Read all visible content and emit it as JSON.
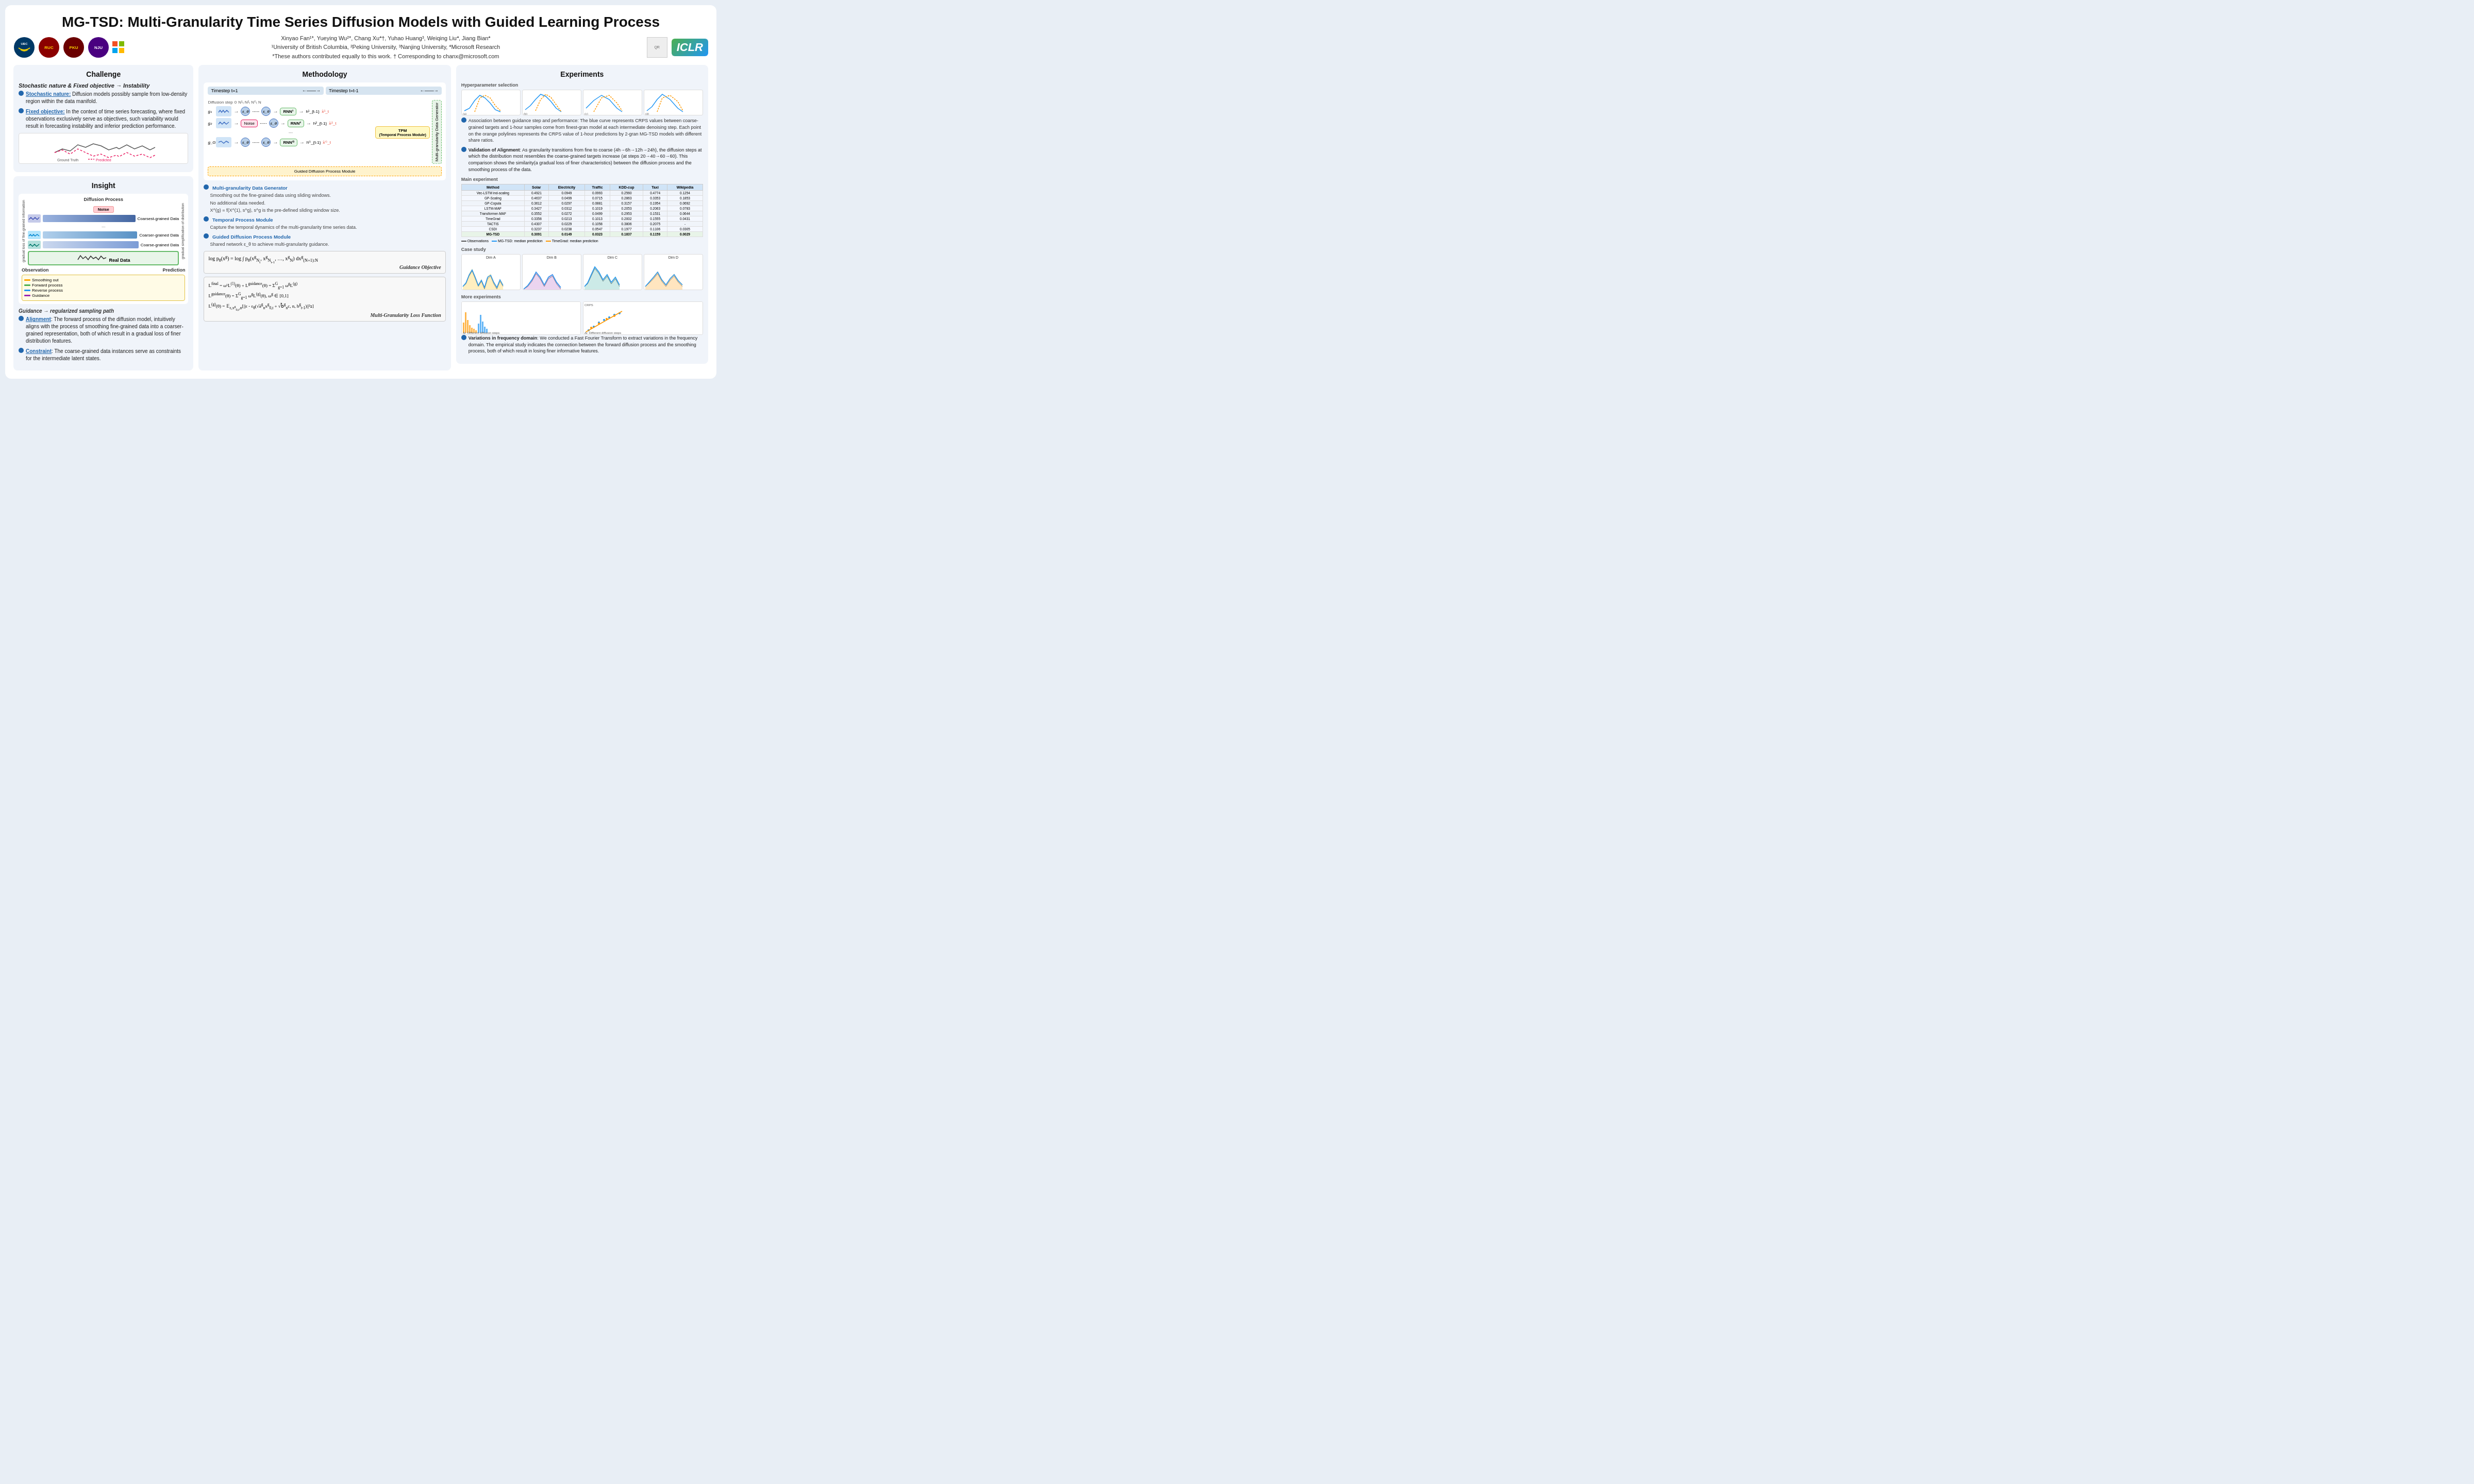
{
  "title": "MG-TSD: Multi-Granularity Time Series Diffusion Models with Guided Learning Process",
  "authors": "Xinyao Fan¹*, Yueying Wu²*, Chang Xu⁴†, Yuhao Huang³, Weiqing Liu⁴, Jiang Bian⁴",
  "affiliations": "¹University of British Columbia, ²Peking University, ³Nanjing University, ⁴Microsoft Research",
  "note": "*These authors contributed equally to this work.  † Corresponding to chanx@microsoft.com",
  "conference": "ICLR",
  "challenge": {
    "title": "Challenge",
    "subtitle": "Stochastic nature & Fixed objective → Instability",
    "bullet1_title": "Stochastic nature:",
    "bullet1_text": "Diffusion models possibly sample from low-density region within the data manifold.",
    "bullet2_title": "Fixed objective:",
    "bullet2_text": "In the context of time series forecasting, where fixed observations exclusively serve as objectives, such variability would result in forecasting instability and inferior prediction performance.",
    "chart_label1": "Ground Truth",
    "chart_label2": "Predicted"
  },
  "insight": {
    "title": "Insight",
    "diffusion_process": "Diffusion Process",
    "noise_label": "Noise",
    "coarsest_label": "Coarsest-grained Data",
    "coarser_label": "Coarser-grained Data",
    "coarse_label": "Coarse-grained Data",
    "real_data_label": "Real Data",
    "observation_label": "Observation",
    "prediction_label": "Prediction",
    "gradient_label": "gradual loss of fine-grained information",
    "gradient_label2": "gradual simplification of distribution",
    "legend_smooth": "Smoothing out",
    "legend_forward": "Forward process",
    "legend_reverse": "Reverse process",
    "legend_guidance": "Guidance",
    "guidance_text": "Guidance → regularized sampling path",
    "align_title": "Alignment",
    "align_text": "The forward process of the diffusion model, intuitively aligns with the process of smoothing fine-grained data into a coarser-grained representation, both of which result in a gradual loss of finer distribution features.",
    "constraint_title": "Constraint",
    "constraint_text": "The coarse-grained data instances serve as constraints for the intermediate latent states."
  },
  "methodology": {
    "title": "Methodology",
    "timestep_label": "Timestep t=1",
    "timestep_label2": "Timestep t=t-1",
    "tpm_label": "TPM\n(Temporal Process Module)",
    "gdp_label": "Guided Diffusion Process Module",
    "multi_gran_label": "Multi-granularity Data Generator",
    "bullet1_title": "Multi-granularity Data Generator",
    "bullet1_sub1": "Smoothing out the fine-grained data using sliding windows.",
    "bullet1_sub2": "No additional data needed.",
    "bullet1_sub3": "X^(g) = f(X^(1), s^g), s^g is the pre-defined sliding window size.",
    "bullet2_title": "Temporal Process Module",
    "bullet2_sub1": "Capture the temporal dynamics of the multi-granularity time series data.",
    "bullet3_title": "Guided Diffusion Process Module",
    "bullet3_sub1": "Shared network ε_θ to achieve multi-granularity guidance.",
    "guidance_formula": "log p_θ(x^g) = log ∫ p_θ(x^g_{N_t}, x^g_{N_{t-1}}, …, x^g_N) dx^g_{(N+1):N}",
    "guidance_title": "Guidance Objective",
    "loss_formula1": "L^final = ω¹L^(1)(θ) + L^guidance(θ) = Σ^G_{g=1} ω^g L^(g)",
    "loss_formula2": "L^guidance(θ) = Σ^G_{g=1} ω^g L^(g)(θ), ω^g ∈ [0,1]",
    "loss_formula3": "L^(g)(θ) = E_{ε,x^g_{0,t},n}[||ε - ε_θ(√ā^g_n x^g_{0,t} + √b^g_n c, n, h^g_{t-1})||²₂]",
    "loss_title": "Multi-Granularity Loss Function"
  },
  "experiments": {
    "title": "Experiments",
    "hyp_title": "Hyperparameter selection",
    "hyp_text": "Association between guidance step and performance: The blue curve represents CRPS values between coarse-grained targets and 1-hour samples come from finest-gran model at each intermediate denoising step. Each point on the orange polylines represents the CRPS value of 1-hour predictions by 2-gran MG-TSD models with different share ratios.",
    "align_title": "Validation of Alignment",
    "align_text": "As granularity transitions from fine to coarse (4h→6h→12h→24h), the diffusion steps at which the distribution most resembles the coarse-grained targets increase (at steps 20→40→60→60). This comparison shows the similarity(a gradual loss of finer characteristics) between the diffusion process and the smoothing process of the data.",
    "table_headers": [
      "Method",
      "Solar",
      "Electricity",
      "Traffic",
      "KDD-cup",
      "Taxi",
      "Wikipedia"
    ],
    "table_rows": [
      [
        "Vec-LSTM ind-scaling",
        "0.4921",
        "0.0949",
        "0.0993",
        "0.2560",
        "0.4774",
        "0.1254"
      ],
      [
        "GP-Scaling",
        "0.4637",
        "0.0499",
        "0.0715",
        "0.2863",
        "0.3353",
        "0.1853"
      ],
      [
        "GP-Copula",
        "0.3612",
        "0.0297",
        "0.0881",
        "0.3157",
        "0.1954",
        "0.0692"
      ],
      [
        "LSTM-MAF",
        "0.3427",
        "0.0312",
        "0.1019",
        "0.2053",
        "0.2063",
        "0.0783"
      ],
      [
        "Transformer-MAF",
        "0.3552",
        "0.0272",
        "0.0499",
        "0.2953",
        "0.1531",
        "0.0644"
      ],
      [
        "TimeGrad",
        "0.3358",
        "0.0213",
        "0.1013",
        "0.2002",
        "0.1555",
        "0.0431"
      ],
      [
        "TACTIS",
        "0.4307",
        "0.0229",
        "0.1058",
        "0.3806",
        "0.2075",
        "-"
      ],
      [
        "CSDI",
        "0.3237",
        "0.0238",
        "0.0547",
        "0.1977",
        "0.1106",
        "0.0305"
      ],
      [
        "MG-TSD",
        "0.3091",
        "0.0149",
        "0.0323",
        "0.1837",
        "0.1159",
        "0.0029"
      ]
    ],
    "case_dims": [
      "Dim A",
      "Dim B",
      "Dim C",
      "Dim D"
    ],
    "more_exp_title": "More experiments",
    "variations_title": "Variations in frequency domain",
    "variations_text": "We conducted a Fast Fourier Transform to extract variations in the frequency domain. The empirical study indicates the connection between the forward diffusion process and the smoothing process, both of which result in losing finer informative features."
  }
}
